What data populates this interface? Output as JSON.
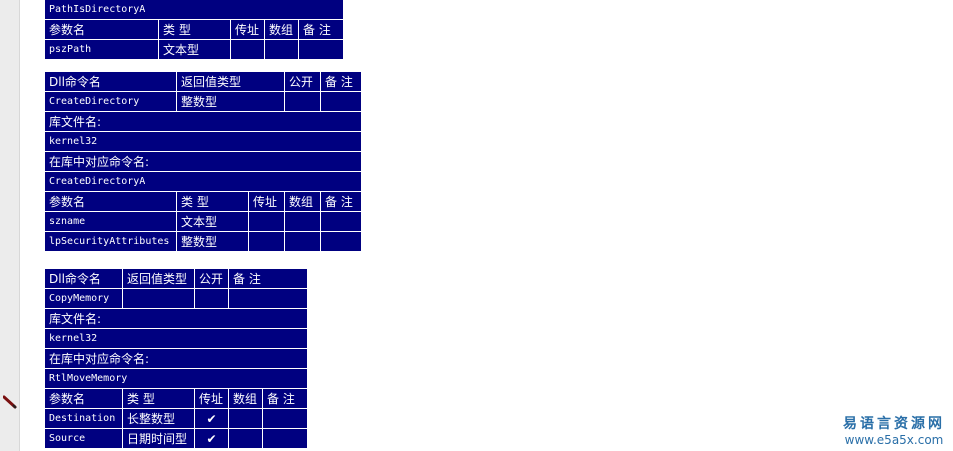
{
  "table0": {
    "title": "PathIsDirectoryA",
    "param_headers": [
      "参数名",
      "类 型",
      "传址",
      "数组",
      "备 注"
    ],
    "params": [
      {
        "name": "pszPath",
        "type": "文本型",
        "byref": "",
        "array": "",
        "note": ""
      }
    ]
  },
  "table1": {
    "headers": [
      "Dll命令名",
      "返回值类型",
      "公开",
      "备 注"
    ],
    "name": "CreateDirectory",
    "return_type": "整数型",
    "public": "",
    "note": "",
    "lib_label": "库文件名:",
    "lib_value": "kernel32",
    "cmd_label": "在库中对应命令名:",
    "cmd_value": "CreateDirectoryA",
    "param_headers": [
      "参数名",
      "类 型",
      "传址",
      "数组",
      "备 注"
    ],
    "params": [
      {
        "name": "szname",
        "type": "文本型",
        "byref": "",
        "array": "",
        "note": ""
      },
      {
        "name": "lpSecurityAttributes",
        "type": "整数型",
        "byref": "",
        "array": "",
        "note": ""
      }
    ]
  },
  "table2": {
    "headers": [
      "Dll命令名",
      "返回值类型",
      "公开",
      "备 注"
    ],
    "name": "CopyMemory",
    "return_type": "",
    "public": "",
    "note": "",
    "lib_label": "库文件名:",
    "lib_value": "kernel32",
    "cmd_label": "在库中对应命令名:",
    "cmd_value": "RtlMoveMemory",
    "param_headers": [
      "参数名",
      "类 型",
      "传址",
      "数组",
      "备 注"
    ],
    "params": [
      {
        "name": "Destination",
        "type": "长整数型",
        "byref": "✔",
        "array": "",
        "note": ""
      },
      {
        "name": "Source",
        "type": "日期时间型",
        "byref": "✔",
        "array": "",
        "note": ""
      }
    ]
  },
  "watermark": {
    "line1": "易语言资源网",
    "line2": "www.e5a5x.com"
  },
  "colors": {
    "table_bg": "#000080",
    "table_text": "#ffffff",
    "gutter": "#ececec",
    "watermark": "#2a6fa8"
  }
}
